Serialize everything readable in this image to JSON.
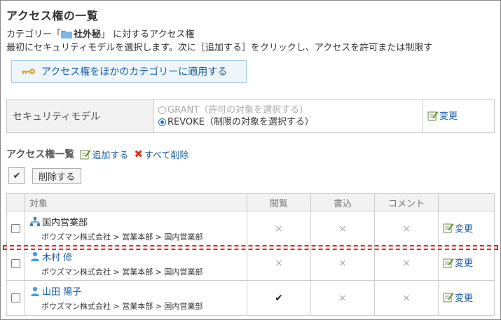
{
  "page": {
    "title": "アクセス権の一覧",
    "category_prefix": "カテゴリー「",
    "category_name": "社外秘",
    "category_suffix": "」 に対するアクセス権",
    "instruction": "最初にセキュリティモデルを選択します。次に［追加する］をクリックし、アクセスを許可または制限す"
  },
  "apply_button": {
    "label": "アクセス権をほかのカテゴリーに適用する",
    "icon": "key-icon"
  },
  "security_model": {
    "label": "セキュリティモデル",
    "options": [
      {
        "label": "GRANT（許可の対象を選択する）",
        "selected": false,
        "disabled": true
      },
      {
        "label": "REVOKE（制限の対象を選択する）",
        "selected": true,
        "disabled": false
      }
    ],
    "edit_label": "変更"
  },
  "acl_list": {
    "label": "アクセス権一覧",
    "add_label": "追加する",
    "delete_all_label": "すべて削除",
    "check_all_glyph": "✔",
    "delete_button_label": "削除する",
    "columns": {
      "target": "対象",
      "view": "閲覧",
      "write": "書込",
      "comment": "コメント"
    },
    "rows": [
      {
        "type": "organization",
        "name": "国内営業部",
        "path": "ボウズマン株式会社 > 営業本部 > 国内営業部",
        "view": "×",
        "write": "×",
        "comment": "×",
        "edit_label": "変更"
      },
      {
        "type": "user",
        "name": "木村 修",
        "path": "ボウズマン株式会社 > 営業本部 > 国内営業部",
        "view": "×",
        "write": "×",
        "comment": "×",
        "edit_label": "変更"
      },
      {
        "type": "user",
        "name": "山田 陽子",
        "path": "ボウズマン株式会社 > 営業本部 > 国内営業部",
        "view": "✔",
        "write": "×",
        "comment": "×",
        "edit_label": "変更"
      }
    ]
  },
  "colors": {
    "link": "#1a5fa6",
    "highlight_dash": "#d82a2a",
    "header_bg": "#f2f2f2",
    "button_bg": "#eef6fc"
  }
}
